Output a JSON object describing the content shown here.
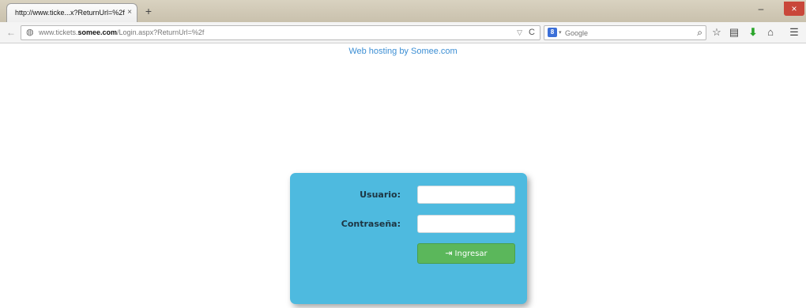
{
  "browser": {
    "tab_title": "http://www.ticke...x?ReturnUrl=%2f",
    "tab_close": "×",
    "new_tab": "+",
    "url_prefix": "www.tickets.",
    "url_domain": "somee.com",
    "url_path": "/Login.aspx?ReturnUrl=%2f",
    "search_engine": "Google",
    "search_engine_badge": "8",
    "search_arrow": "▾",
    "url_dropdown": "▽",
    "url_reload": "C",
    "window_min": "–",
    "window_max": "❐",
    "window_close": "×"
  },
  "page": {
    "hosting_link": "Web hosting by Somee.com"
  },
  "login": {
    "user_label": "Usuario:",
    "password_label": "Contraseña:",
    "user_value": "",
    "password_value": "",
    "submit_label": "Ingresar",
    "submit_icon": "⇥"
  },
  "icons": {
    "search_go": "⌕",
    "bookmark": "☆",
    "bookmarks_menu": "▤",
    "download": "⬇",
    "home": "⌂",
    "menu": "☰",
    "back": "←",
    "globe": "◍"
  },
  "colors": {
    "card": "#4ebadf",
    "button": "#5bb75b",
    "link": "#3d8fd4",
    "download_icon": "#2aa52a"
  }
}
